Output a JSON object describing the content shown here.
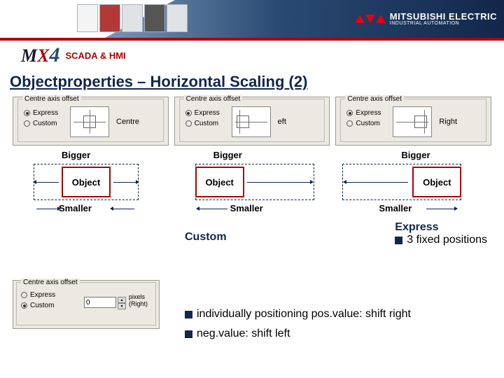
{
  "brand": {
    "company": "MITSUBISHI ELECTRIC",
    "division": "INDUSTRIAL AUTOMATION",
    "product_prefix": "M",
    "product_x": "X",
    "product_num": "4",
    "subtitle": "SCADA & HMI"
  },
  "title": "Objectproperties – Horizontal Scaling (2)",
  "panels": [
    {
      "legend": "Centre axis offset",
      "opt1": "Express",
      "opt2": "Custom",
      "side": "Centre",
      "selected": 0
    },
    {
      "legend": "Centre axis offset",
      "opt1": "Express",
      "opt2": "Custom",
      "side": "eft",
      "selected": 0
    },
    {
      "legend": "Centre axis offset",
      "opt1": "Express",
      "opt2": "Custom",
      "side": "Right",
      "selected": 0
    }
  ],
  "diagram_labels": {
    "bigger": "Bigger",
    "object": "Object",
    "smaller": "Smaller"
  },
  "express": {
    "title": "Express",
    "bullet": "3 fixed positions"
  },
  "custom": {
    "title": "Custom",
    "bullet1": "individually positioning pos.value: shift right",
    "bullet2": "neg.value: shift left"
  },
  "custom_panel": {
    "legend": "Centre axis offset",
    "opt1": "Express",
    "opt2": "Custom",
    "value": "0",
    "unit_top": "pixels",
    "unit_bottom": "(Right)"
  }
}
